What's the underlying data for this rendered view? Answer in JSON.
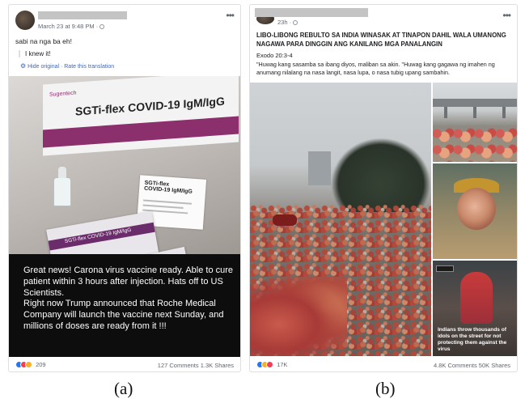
{
  "post_a": {
    "timestamp": "March 23 at 9:48 PM · ",
    "status_text": "sabi na nga ba eh!",
    "translated_text": "I knew it!",
    "translation_links": "Hide original · Rate this translation",
    "photo": {
      "box_brand": "Sugentech",
      "box_title": "SGTi-flex COVID-19 IgM/IgG",
      "card_title_1": "SGTi-flex",
      "card_title_2": "COVID-19 IgM/IgG",
      "pouch_label": "SGTi-flex COVID-19 IgM/IgG"
    },
    "overlay_text": "Great news! Carona virus vaccine ready. Able to cure patient within 3 hours after injection. Hats off to US Scientists.\nRight now  Trump announced that Roche Medical Company will launch the vaccine next Sunday, and millions of doses are ready from it !!!",
    "reaction_count": "209",
    "engagement": "127 Comments  1.3K Shares",
    "more_label": "•••"
  },
  "post_b": {
    "timestamp": "23h · ",
    "headline": "LIBO-LIBONG REBULTO SA INDIA WINASAK AT TINAPON DAHIL WALA UMANONG NAGAWA PARA DINGGIN ANG KANILANG MGA PANALANGIN",
    "verse_ref": "Exodo 20:3-4",
    "verse_text": "\"Huwag kang sasamba sa ibang diyos, maliban sa akin. \"Huwag kang gagawa ng imahen ng anumang nilalang na nasa langit, nasa lupa, o nasa tubig upang sambahin.",
    "photo_caption": "Indians throw thousands of idols on the street for not protecting them against the virus",
    "reaction_count": "17K",
    "engagement": "4.8K Comments  50K Shares",
    "more_label": "•••"
  },
  "labels": {
    "a": "(a)",
    "b": "(b)"
  },
  "colors": {
    "link_blue": "#4267b2",
    "like": "#2078f4",
    "love": "#f33e58",
    "wow": "#f7b125",
    "panel": "#0d0d0d"
  }
}
